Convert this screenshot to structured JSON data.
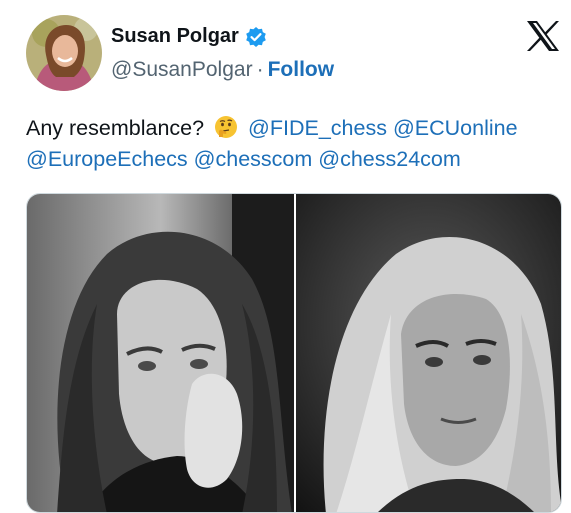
{
  "author": {
    "name": "Susan Polgar",
    "handle": "@SusanPolgar",
    "separator": "·",
    "follow_label": "Follow",
    "verified_icon": "verified-badge-icon"
  },
  "tweet": {
    "text_prefix": "Any resemblance?",
    "emoji": "thinking-face-icon",
    "mentions": [
      "@FIDE_chess",
      "@ECUonline",
      "@EuropeEchecs",
      "@chesscom",
      "@chess24com"
    ]
  },
  "media": {
    "photos": [
      {
        "description": "black-and-white-portrait-left",
        "icon": "photo"
      },
      {
        "description": "black-and-white-portrait-right",
        "icon": "photo"
      }
    ]
  },
  "colors": {
    "link": "#1d6fb8",
    "verified": "#1d9bf0",
    "muted": "#536471",
    "text": "#0f1419"
  }
}
